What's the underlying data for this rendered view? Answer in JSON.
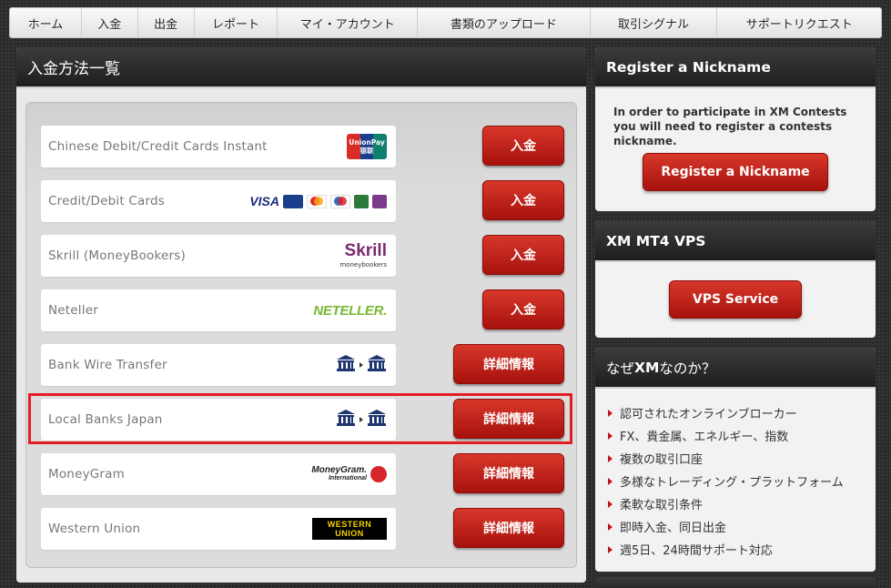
{
  "nav": {
    "items": [
      {
        "label": "ホーム",
        "width": 79
      },
      {
        "label": "入金",
        "width": 62
      },
      {
        "label": "出金",
        "width": 62
      },
      {
        "label": "レポート",
        "width": 92
      },
      {
        "label": "マイ・アカウント",
        "width": 154
      },
      {
        "label": "書類のアップロード",
        "width": 190
      },
      {
        "label": "取引シグナル",
        "width": 140
      },
      {
        "label": "サポートリクエスト",
        "width": 180
      }
    ]
  },
  "main": {
    "title": "入金方法一覧",
    "methods": [
      {
        "name": "Chinese Debit/Credit Cards Instant",
        "logo": "unionpay-logo",
        "button": "入金",
        "button_type": "deposit"
      },
      {
        "name": "Credit/Debit Cards",
        "logo": "cards-logo",
        "button": "入金",
        "button_type": "deposit"
      },
      {
        "name": "Skrill (MoneyBookers)",
        "logo": "skrill-logo",
        "button": "入金",
        "button_type": "deposit"
      },
      {
        "name": "Neteller",
        "logo": "neteller-logo",
        "button": "入金",
        "button_type": "deposit"
      },
      {
        "name": "Bank Wire Transfer",
        "logo": "bank-transfer-icon",
        "button": "詳細情報",
        "button_type": "details"
      },
      {
        "name": "Local Banks Japan",
        "logo": "bank-transfer-icon",
        "button": "詳細情報",
        "button_type": "details",
        "highlighted": true
      },
      {
        "name": "MoneyGram",
        "logo": "moneygram-logo",
        "button": "詳細情報",
        "button_type": "details"
      },
      {
        "name": "Western Union",
        "logo": "western-union-logo",
        "button": "詳細情報",
        "button_type": "details"
      }
    ],
    "logos": {
      "unionpay_text": "UnionPay",
      "unionpay_cn": "银联",
      "visa": "VISA",
      "skrill": "Skrill",
      "skrill_sub": "moneybookers",
      "neteller": "NETELLER.",
      "moneygram": "MoneyGram.",
      "moneygram_sub": "International",
      "wu_line1": "WESTERN",
      "wu_line2": "UNION"
    }
  },
  "sidebar": {
    "nickname": {
      "title": "Register a Nickname",
      "text": "In order to participate in XM Contests you will need to register a contests nickname.",
      "button": "Register a Nickname"
    },
    "vps": {
      "title": "XM MT4 VPS",
      "button": "VPS Service"
    },
    "why": {
      "title_prefix": "なぜ",
      "title_brand": "XM",
      "title_suffix": "なのか？",
      "items": [
        "認可されたオンラインブローカー",
        "FX、貴金属、エネルギー、指数",
        "複数の取引口座",
        "多様なトレーディング・プラットフォーム",
        "柔軟な取引条件",
        "即時入金、同日出金",
        "週5日、24時間サポート対応"
      ]
    }
  },
  "colors": {
    "accent_red": "#c0141a",
    "highlight_border": "#e41c24",
    "header_dark": "#1e1e1e"
  }
}
